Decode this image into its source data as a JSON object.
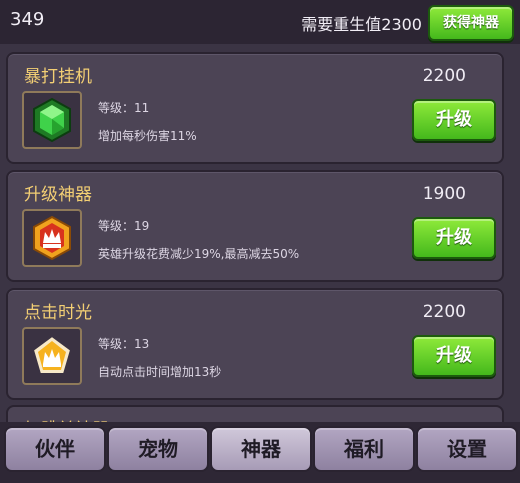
{
  "header": {
    "currency": "349",
    "rebirth_requirement": "需要重生值2300",
    "get_artifact_button": "获得神器"
  },
  "artifacts": [
    {
      "name": "暴打挂机",
      "cost": "2200",
      "level": "等级：11",
      "effect": "增加每秒伤害11%",
      "upgrade_label": "升级",
      "icon": "green-gem-icon"
    },
    {
      "name": "升级神器",
      "cost": "1900",
      "level": "等级：19",
      "effect": "英雄升级花费减少19%,最高减去50%",
      "upgrade_label": "升级",
      "icon": "red-crown-badge-icon"
    },
    {
      "name": "点击时光",
      "cost": "2200",
      "level": "等级：13",
      "effect": "自动点击时间增加13秒",
      "upgrade_label": "升级",
      "icon": "gold-crown-pentagon-icon"
    }
  ],
  "partial_card": {
    "name": "加跳兰神器"
  },
  "tabs": [
    {
      "label": "伙伴",
      "active": false
    },
    {
      "label": "宠物",
      "active": false
    },
    {
      "label": "神器",
      "active": true
    },
    {
      "label": "福利",
      "active": false
    },
    {
      "label": "设置",
      "active": false
    }
  ]
}
